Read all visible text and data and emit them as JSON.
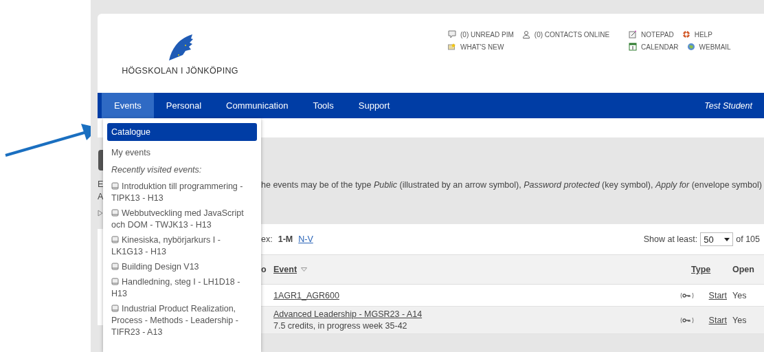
{
  "header": {
    "logo_text": "HÖGSKOLAN I JÖNKÖPING",
    "link_groups": [
      {
        "rows": [
          [
            {
              "label": "(0) UNREAD PIM",
              "kind": "pim"
            },
            {
              "label": "(0) CONTACTS ONLINE",
              "kind": "contacts"
            }
          ],
          [
            {
              "label": "WHAT'S NEW",
              "kind": "news"
            }
          ]
        ]
      },
      {
        "rows": [
          [
            {
              "label": "NOTEPAD",
              "kind": "notepad"
            },
            {
              "label": "HELP",
              "kind": "help"
            }
          ],
          [
            {
              "label": "CALENDAR",
              "kind": "calendar"
            },
            {
              "label": "WEBMAIL",
              "kind": "webmail"
            }
          ]
        ]
      }
    ]
  },
  "nav": {
    "items": [
      {
        "label": "Events",
        "selected": true
      },
      {
        "label": "Personal",
        "selected": false
      },
      {
        "label": "Communication",
        "selected": false
      },
      {
        "label": "Tools",
        "selected": false
      },
      {
        "label": "Support",
        "selected": false
      }
    ],
    "user": "Test Student"
  },
  "menu": {
    "items": [
      {
        "kind": "link",
        "label": "Catalogue",
        "selected": true
      },
      {
        "kind": "link",
        "label": "My events",
        "selected": false
      },
      {
        "kind": "heading",
        "label": "Recently visited events:"
      },
      {
        "kind": "event",
        "label": "Introduktion till programmering - TIPK13 - H13"
      },
      {
        "kind": "event",
        "label": "Webbutveckling med JavaScript och DOM - TWJK13 - H13"
      },
      {
        "kind": "event",
        "label": "Kinesiska, nybörjarkurs I - LK1G13 - H13"
      },
      {
        "kind": "event",
        "label": "Building Design V13"
      },
      {
        "kind": "event",
        "label": "Handledning, steg I - LH1D18 - H13"
      },
      {
        "kind": "event",
        "label": "Industrial Product Realization, Process - Methods - Leadership - TIFR23 - A13"
      }
    ]
  },
  "content": {
    "fragments": [
      "E",
      "A"
    ],
    "paragraph": "he events may be of the type *Public* (illustrated by an arrow symbol), *Password protected* (key symbol), *Apply for* (envelope symbol)",
    "index": {
      "prefix": "ex:",
      "items": [
        {
          "label": "1-M",
          "selected": true
        },
        {
          "label": "N-V",
          "selected": false
        }
      ]
    },
    "show_at_least": {
      "label": "Show at least:",
      "value": "50",
      "suffix": "of 105"
    },
    "table": {
      "columns": [
        "o",
        "Event",
        "Type",
        "Open"
      ],
      "rows": [
        {
          "event": "1AGR1_AGR600",
          "action": "Start",
          "open": "Yes"
        },
        {
          "event": "Advanced Leadership - MGSR23 - A14",
          "subtitle": "7.5 credits, in progress week 35-42",
          "action": "Start",
          "open": "Yes"
        }
      ]
    }
  }
}
